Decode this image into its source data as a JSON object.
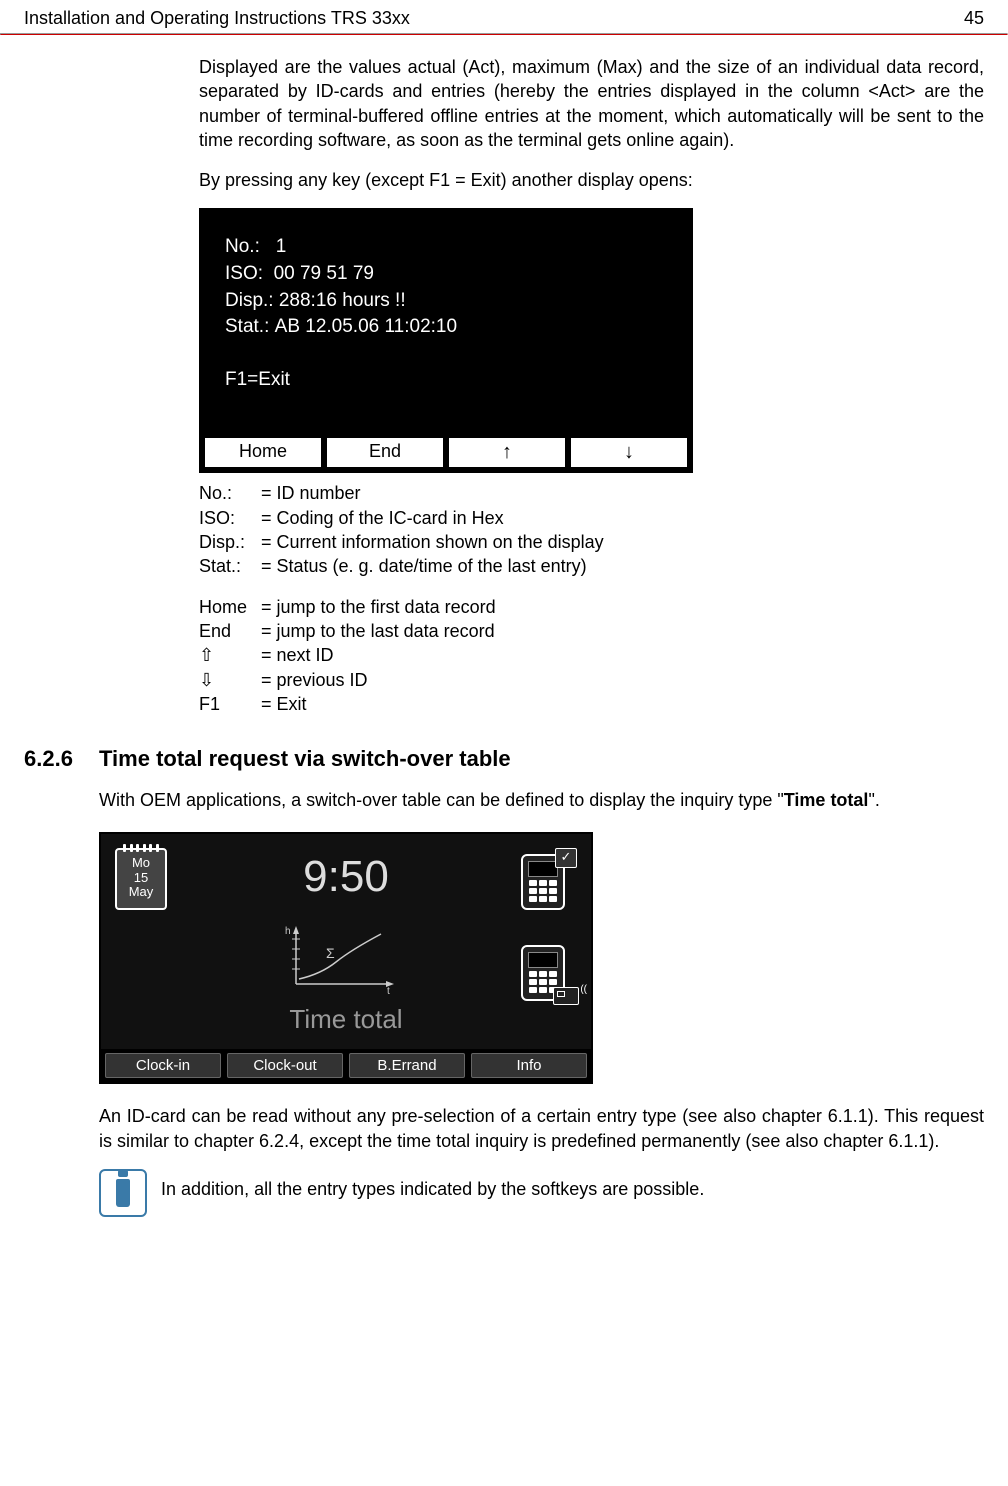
{
  "header": {
    "title": "Installation and Operating Instructions TRS 33xx",
    "page": "45"
  },
  "p1": "Displayed are the values actual (Act), maximum (Max) and the size of an individual data record, separated by ID-cards and entries (hereby the entries displayed in the column <Act> are the number of terminal-buffered offline entries at the moment, which automatically will be sent to the time recording software, as soon as the terminal gets online again).",
  "p2": "By pressing any key (except F1 = Exit) another display opens:",
  "screen1": {
    "no_label": "No.:",
    "no_val": "1",
    "iso_label": "ISO:",
    "iso_val": "00 79 51 79",
    "disp_label": "Disp.:",
    "disp_val": "288:16 hours !!",
    "stat_label": "Stat.:",
    "stat_val": "AB 12.05.06  11:02:10",
    "exit": "F1=Exit",
    "btn_home": "Home",
    "btn_end": "End"
  },
  "defs": {
    "no": {
      "k": "No.:",
      "v": "= ID number"
    },
    "iso": {
      "k": "ISO:",
      "v": "= Coding of the IC-card in Hex"
    },
    "disp": {
      "k": "Disp.:",
      "v": "= Current information shown on the display"
    },
    "stat": {
      "k": "Stat.:",
      "v": "= Status (e. g. date/time of the last entry)"
    },
    "home": {
      "k": "Home",
      "v": "= jump to the first data record"
    },
    "end": {
      "k": "End",
      "v": "= jump to the last data record"
    },
    "up": {
      "k": "⇧",
      "v": "= next ID"
    },
    "down": {
      "k": "⇩",
      "v": "= previous ID"
    },
    "f1": {
      "k": "F1",
      "v": "= Exit"
    }
  },
  "section": {
    "num": "6.2.6",
    "title": "Time total request via switch-over table"
  },
  "p3_a": "With OEM applications, a switch-over table can be defined to display the inquiry type \"",
  "p3_b": "Time total",
  "p3_c": "\".",
  "screen2": {
    "cal_day": "Mo",
    "cal_num": "15",
    "cal_mon": "May",
    "time": "9:50",
    "label": "Time total",
    "sigma": "Σ",
    "h": "h",
    "t": "t",
    "btn1": "Clock-in",
    "btn2": "Clock-out",
    "btn3": "B.Errand",
    "btn4": "Info"
  },
  "p4": "An ID-card can be read without any pre-selection of a certain entry type (see also chapter 6.1.1). This request is similar to chapter 6.2.4, except the time total inquiry is predefined permanently (see also chapter 6.1.1).",
  "info": "In addition, all the entry types indicated by the softkeys are possible."
}
